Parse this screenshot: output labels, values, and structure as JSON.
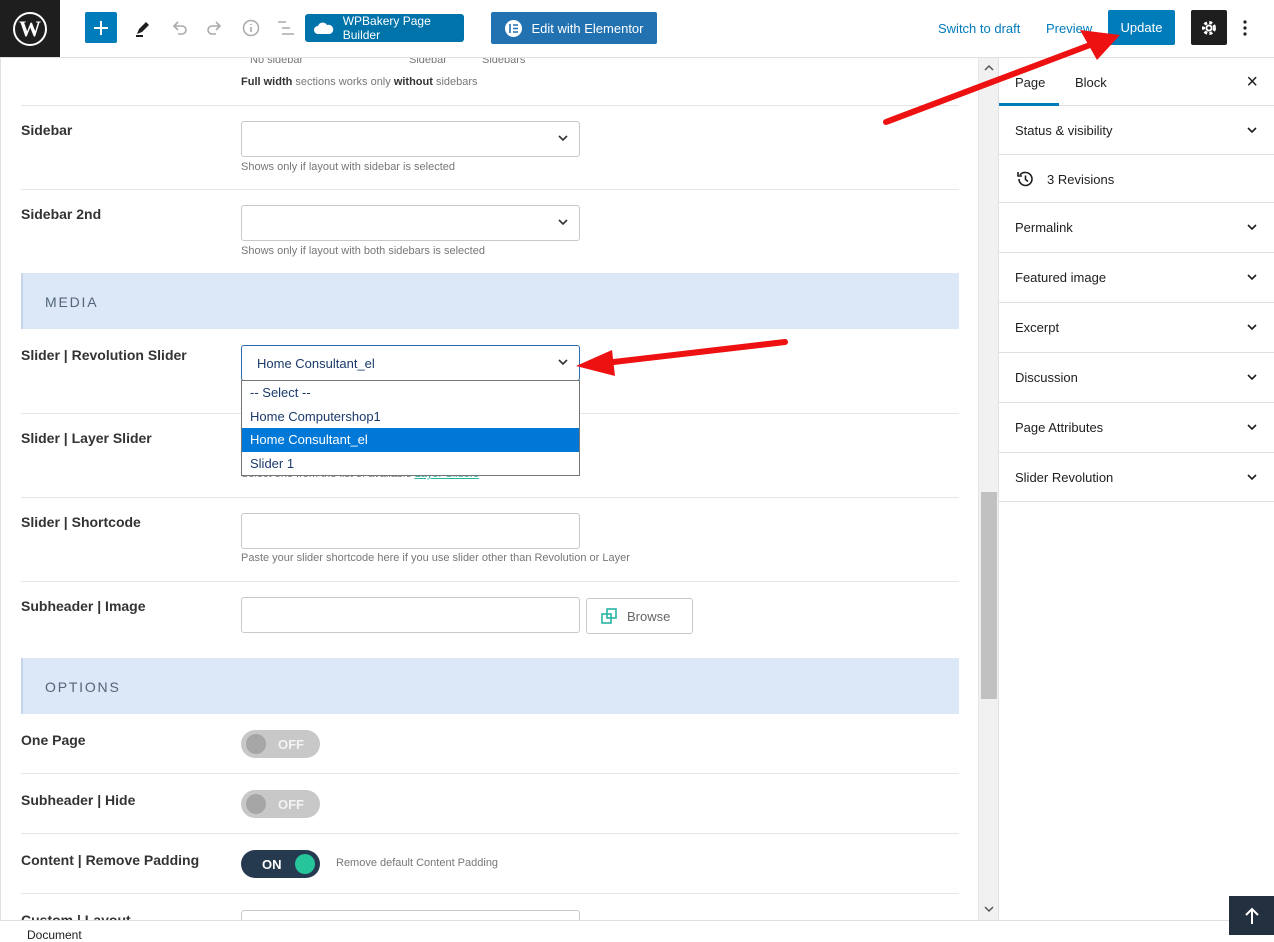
{
  "toolbar": {
    "wpbakery_label": "WPBakery Page Builder",
    "elementor_label": "Edit with Elementor",
    "switch_draft_label": "Switch to draft",
    "preview_label": "Preview",
    "update_label": "Update",
    "icons": [
      "wordpress-logo-icon",
      "plus-icon",
      "pencil-icon",
      "undo-icon",
      "redo-icon",
      "info-icon",
      "list-view-icon",
      "gear-icon",
      "more-icon"
    ]
  },
  "layout_top": {
    "option_labels": [
      "No sidebar",
      "Sidebar",
      "Sidebars"
    ],
    "note_bold1": "Full width",
    "note_mid": " sections works only ",
    "note_bold2": "without",
    "note_end": " sidebars"
  },
  "fields": {
    "sidebar": {
      "label": "Sidebar",
      "value": "",
      "help": "Shows only if layout with sidebar is selected"
    },
    "sidebar2": {
      "label": "Sidebar 2nd",
      "value": "",
      "help": "Shows only if layout with both sidebars is selected"
    },
    "media_section": "MEDIA",
    "rev_slider": {
      "label": "Slider | Revolution Slider",
      "value": "Home Consultant_el",
      "options": [
        "-- Select --",
        "Home Computershop1",
        "Home Consultant_el",
        "Slider 1"
      ],
      "selected_index": 2
    },
    "layer_slider": {
      "label": "Slider | Layer Slider",
      "help_prefix": "Select one from the list of available ",
      "help_link": "Layer Sliders"
    },
    "shortcode": {
      "label": "Slider | Shortcode",
      "value": "",
      "help": "Paste your slider shortcode here if you use slider other than Revolution or Layer"
    },
    "subheader_image": {
      "label": "Subheader | Image",
      "value": "",
      "browse_label": "Browse"
    },
    "options_section": "OPTIONS",
    "one_page": {
      "label": "One Page",
      "state": "OFF"
    },
    "subheader_hide": {
      "label": "Subheader | Hide",
      "state": "OFF"
    },
    "remove_padding": {
      "label": "Content | Remove Padding",
      "state": "ON",
      "help": "Remove default Content Padding"
    },
    "custom_layout": {
      "label": "Custom | Layout"
    }
  },
  "sidebar": {
    "tab_page": "Page",
    "tab_block": "Block",
    "close_label": "×",
    "panels": [
      {
        "label": "Status & visibility",
        "icon": "chevron-down-icon"
      },
      {
        "label": "3 Revisions",
        "icon": "history-icon"
      },
      {
        "label": "Permalink",
        "icon": "chevron-down-icon"
      },
      {
        "label": "Featured image",
        "icon": "chevron-down-icon"
      },
      {
        "label": "Excerpt",
        "icon": "chevron-down-icon"
      },
      {
        "label": "Discussion",
        "icon": "chevron-down-icon"
      },
      {
        "label": "Page Attributes",
        "icon": "chevron-down-icon"
      },
      {
        "label": "Slider Revolution",
        "icon": "chevron-down-icon"
      }
    ]
  },
  "footer": {
    "breadcrumb": "Document"
  },
  "colors": {
    "accent": "#007cba",
    "annotation": "#ee1111",
    "toggle_on": "#26c49a",
    "section_bg": "#dce7f7"
  }
}
